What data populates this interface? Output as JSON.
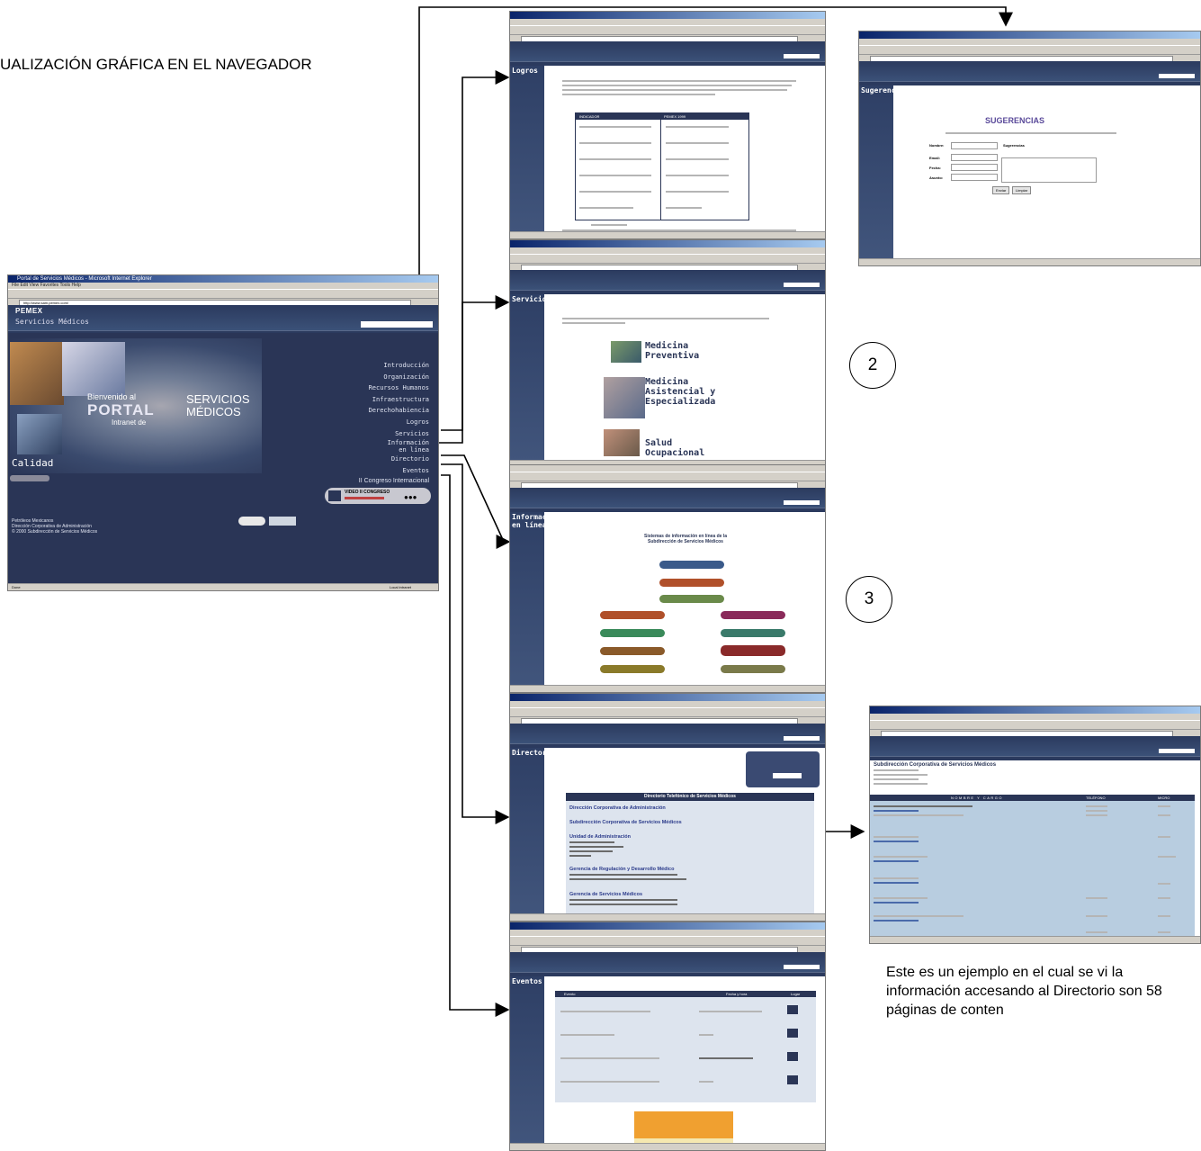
{
  "heading": "UALIZACIÓN GRÁFICA EN EL NAVEGADOR",
  "circle_2": "2",
  "circle_3": "3",
  "caption": "Este es un ejemplo en el cual se vi la información accesando al Directorio son 58 páginas de conten",
  "main_window": {
    "title": "Portal de Servicios Médicos - Microsoft Internet Explorer",
    "address": "http://www.sam.pemex.com/",
    "brand": "PEMEX",
    "subbrand": "Servicios Médicos",
    "banner_welcome": "Bienvenido al",
    "banner_portal": "PORTAL",
    "banner_intranet": "Intranet de",
    "banner_servicios": "SERVICIOS",
    "banner_medicos": "MÉDICOS",
    "calidad": "Calidad",
    "video": "VIDEO II CONGRESO",
    "menu": [
      "Introducción",
      "Organización",
      "Recursos Humanos",
      "Infraestructura",
      "Derechohabiencia",
      "Logros",
      "Servicios",
      "Información en línea",
      "Directorio",
      "Eventos",
      "II Congreso Internacional"
    ],
    "footer": [
      "Petróleos Mexicanos",
      "Dirección Corporativa de Administración",
      "© 2000 Subdirección de Servicios Médicos"
    ],
    "status": "Done",
    "zone": "Local intranet"
  },
  "pages": {
    "logros": {
      "title": "Logros",
      "th1": "INDICADOR",
      "th2": "PEMEX 1999"
    },
    "servicios": {
      "title": "Servicios",
      "items": [
        "Medicina Preventiva",
        "Medicina Asistencial y Especializada",
        "Salud Ocupacional"
      ]
    },
    "informacion": {
      "title": "Información en línea",
      "heading": "Sistemas de información en línea de la Subdirección de Servicios Médicos"
    },
    "directorio": {
      "title": "Directorio SM",
      "banner": "Directorio Telefónico de Servicios Médicos",
      "sections": [
        "Dirección Corporativa de Administración",
        "Subdirección Corporativa de Servicios Médicos",
        "Unidad de Administración",
        "Gerencia de Regulación y Desarrollo Médico",
        "Gerencia de Servicios Médicos"
      ]
    },
    "eventos": {
      "title": "Eventos",
      "cols": [
        "Evento",
        "Fecha y hora",
        "Lugar"
      ]
    },
    "sugerencias": {
      "title": "Sugerencias",
      "heading": "SUGERENCIAS",
      "labels": [
        "Nombre:",
        "Sugerencias",
        "Email:",
        "Fecha:",
        "Asunto:"
      ],
      "buttons": [
        "Enviar",
        "Limpiar"
      ]
    },
    "dir_detail": {
      "title": "Subdirección Corporativa de Servicios Médicos",
      "cols": [
        "NOMBRE Y CARGO",
        "TELÉFONO",
        "MICRO"
      ]
    }
  }
}
